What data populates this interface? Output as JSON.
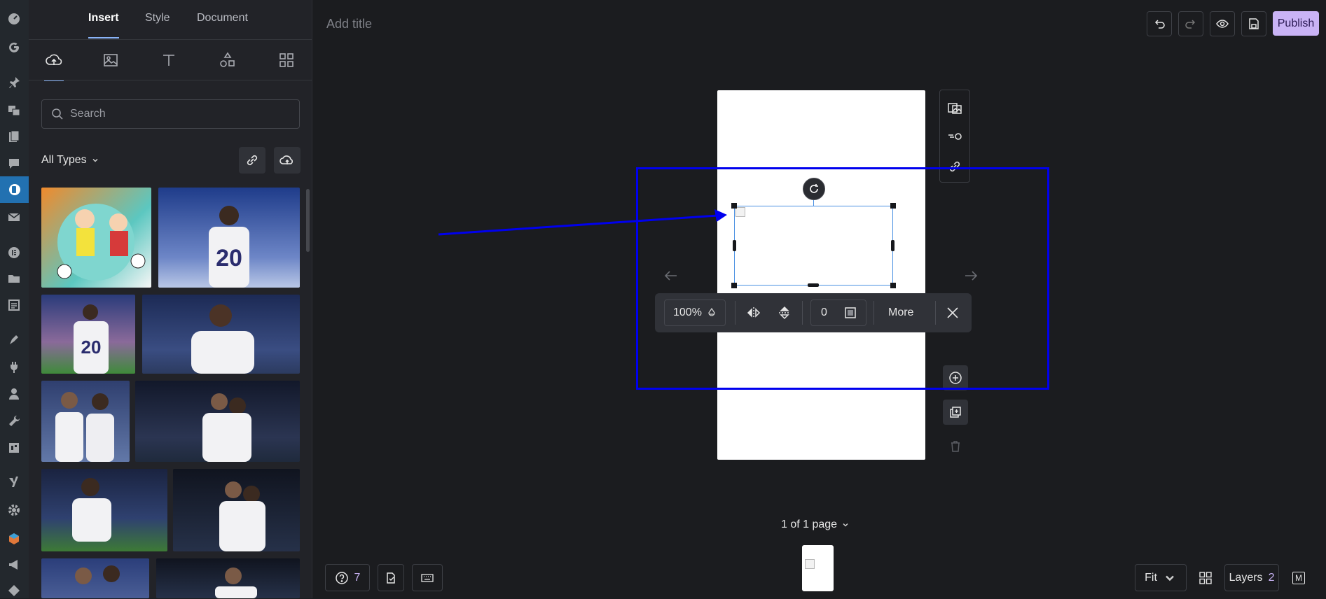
{
  "panel": {
    "tabs": [
      {
        "label": "Insert"
      },
      {
        "label": "Style"
      },
      {
        "label": "Document"
      }
    ],
    "search_placeholder": "Search",
    "filter_label": "All Types"
  },
  "topbar": {
    "title_placeholder": "Add title",
    "publish_label": "Publish"
  },
  "float_toolbar": {
    "opacity": "100%",
    "border_value": "0",
    "more_label": "More"
  },
  "footer": {
    "page_indicator": "1 of 1 page",
    "help_count": "7",
    "zoom_label": "Fit",
    "layers_label": "Layers",
    "layers_count": "2",
    "mode_label": "M"
  },
  "colors": {
    "accent": "#8ab4f8",
    "publish_bg": "#c9b3f5",
    "annotation": "#0000ee",
    "wp_active": "#2271b1"
  }
}
